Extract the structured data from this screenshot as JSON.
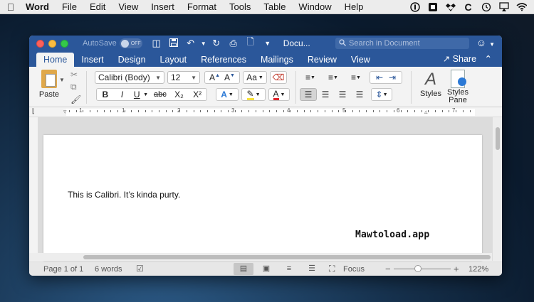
{
  "menubar": {
    "app_name": "Word",
    "items": [
      "File",
      "Edit",
      "View",
      "Insert",
      "Format",
      "Tools",
      "Table",
      "Window",
      "Help"
    ],
    "status_icons": [
      "1password-icon",
      "clipboard-icon",
      "dropbox-icon",
      "c-icon",
      "time-machine-icon",
      "airplay-icon",
      "wifi-icon"
    ]
  },
  "window": {
    "autosave_label": "AutoSave",
    "autosave_state": "OFF",
    "doc_title": "Docu...",
    "search_placeholder": "Search in Document"
  },
  "tabs": [
    {
      "label": "Home",
      "active": true
    },
    {
      "label": "Insert"
    },
    {
      "label": "Design"
    },
    {
      "label": "Layout"
    },
    {
      "label": "References"
    },
    {
      "label": "Mailings"
    },
    {
      "label": "Review"
    },
    {
      "label": "View"
    }
  ],
  "share_label": "Share",
  "ribbon": {
    "paste_label": "Paste",
    "font_name": "Calibri (Body)",
    "font_size": "12",
    "bold": "B",
    "italic": "I",
    "underline": "U",
    "strike": "abc",
    "subscript": "X₂",
    "superscript": "X²",
    "styles_label": "Styles",
    "styles_pane_label": "Styles Pane",
    "highlight_color": "#f7e03a",
    "font_color": "#e0232a"
  },
  "ruler_numbers": [
    "1",
    "1",
    "2",
    "3",
    "4",
    "5",
    "6",
    "7"
  ],
  "document": {
    "text": "This is Calibri. It’s kinda purty."
  },
  "statusbar": {
    "page": "Page 1 of 1",
    "words": "6 words",
    "focus_label": "Focus",
    "zoom": "122%",
    "zoom_level_percent": 122
  },
  "watermark": "Mawtoload.app",
  "colors": {
    "accent": "#2b579a",
    "ribbon_bg": "#f3f3f3"
  }
}
